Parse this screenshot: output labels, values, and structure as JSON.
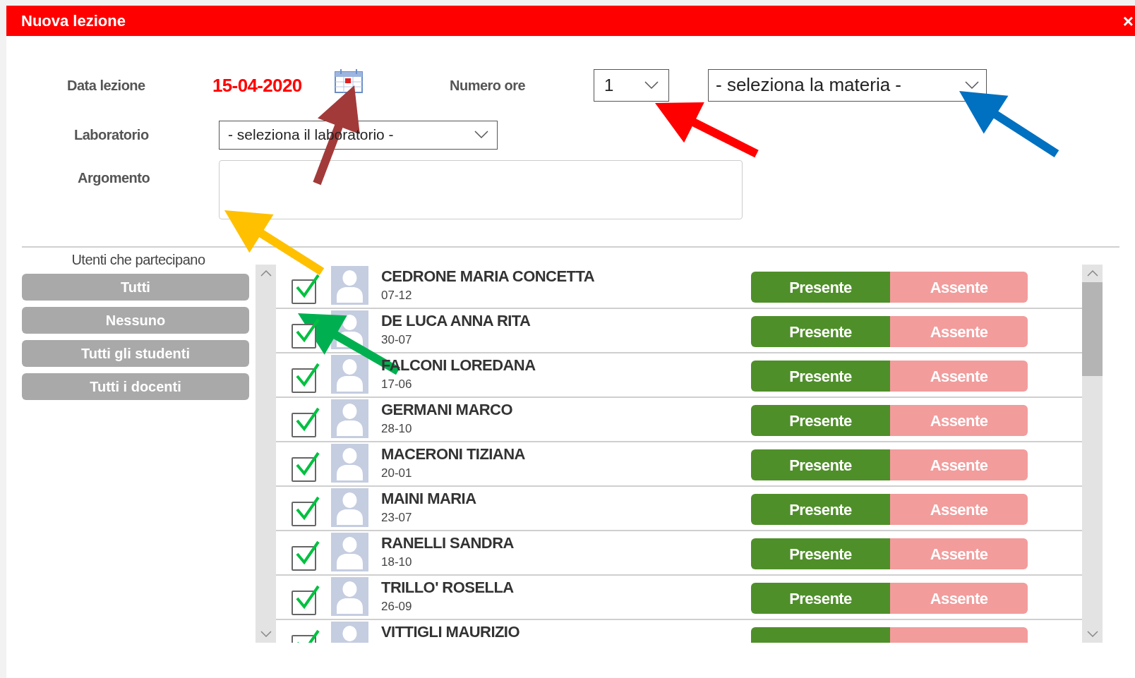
{
  "dialog": {
    "title": "Nuova lezione",
    "close": "×"
  },
  "form": {
    "date_label": "Data lezione",
    "date": "15-04-2020",
    "hours_label": "Numero ore",
    "hours": "1",
    "subject": "- seleziona la materia -",
    "lab_label": "Laboratorio",
    "lab": "- seleziona il laboratorio -",
    "topic_label": "Argomento"
  },
  "participants": {
    "title": "Utenti che partecipano",
    "filters": [
      "Tutti",
      "Nessuno",
      "Tutti gli studenti",
      "Tutti i docenti"
    ],
    "users": [
      {
        "name": "CEDRONE MARIA CONCETTA",
        "date": "07-12",
        "checked": true,
        "present": true,
        "present_label": "Presente",
        "absent_label": "Assente"
      },
      {
        "name": "DE LUCA ANNA RITA",
        "date": "30-07",
        "checked": true,
        "present": true,
        "present_label": "Presente",
        "absent_label": "Assente"
      },
      {
        "name": "FALCONI LOREDANA",
        "date": "17-06",
        "checked": true,
        "present": true,
        "present_label": "Presente",
        "absent_label": "Assente"
      },
      {
        "name": "GERMANI MARCO",
        "date": "28-10",
        "checked": true,
        "present": true,
        "present_label": "Presente",
        "absent_label": "Assente"
      },
      {
        "name": "MACERONI TIZIANA",
        "date": "20-01",
        "checked": true,
        "present": true,
        "present_label": "Presente",
        "absent_label": "Assente"
      },
      {
        "name": "MAINI MARIA",
        "date": "23-07",
        "checked": true,
        "present": true,
        "present_label": "Presente",
        "absent_label": "Assente"
      },
      {
        "name": "RANELLI SANDRA",
        "date": "18-10",
        "checked": true,
        "present": true,
        "present_label": "Presente",
        "absent_label": "Assente"
      },
      {
        "name": "TRILLO' ROSELLA",
        "date": "26-09",
        "checked": true,
        "present": true,
        "present_label": "Presente",
        "absent_label": "Assente"
      },
      {
        "name": "VITTIGLI MAURIZIO",
        "checked": true,
        "present": true
      }
    ]
  },
  "annotation_arrows": [
    {
      "color": "#a33a3a"
    },
    {
      "color": "#ff0000"
    },
    {
      "color": "#0070c0"
    },
    {
      "color": "#ffc000"
    },
    {
      "color": "#00b050"
    }
  ]
}
